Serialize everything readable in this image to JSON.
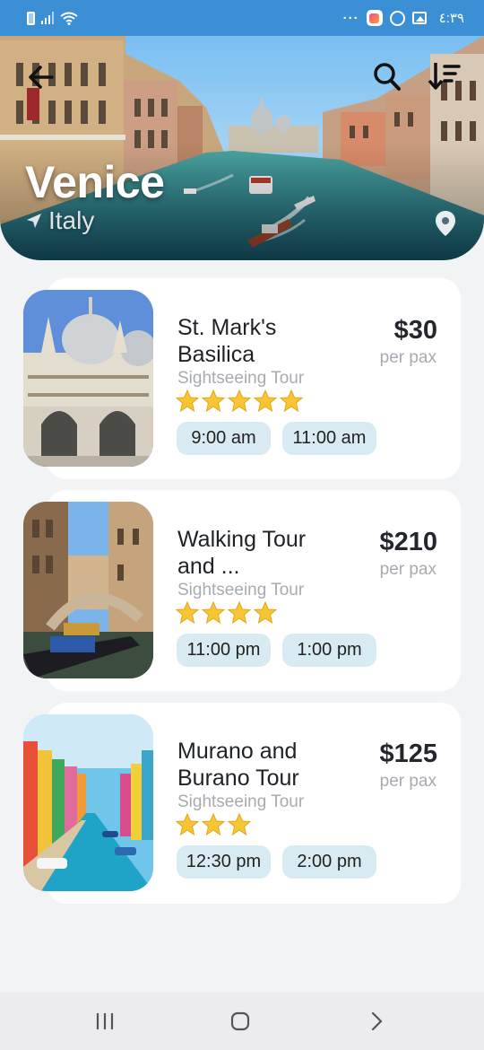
{
  "status_bar": {
    "time": "٤:٣٩",
    "dots": "···",
    "icons": [
      "battery-icon",
      "signal-icon",
      "wifi-icon",
      "health-app-icon",
      "whatsapp-icon",
      "gallery-icon"
    ]
  },
  "header": {
    "city": "Venice",
    "country": "Italy",
    "icons": [
      "back-arrow-icon",
      "search-icon",
      "sort-icon",
      "navigation-arrow-icon",
      "location-pin-icon"
    ]
  },
  "tours": [
    {
      "title_line1": "St. Mark's",
      "title_line2": "Basilica",
      "category": "Sightseeing Tour",
      "price": "$30",
      "price_unit": "per pax",
      "rating": 5,
      "times": [
        "9:00 am",
        "11:00 am"
      ]
    },
    {
      "title_line1": "Walking Tour",
      "title_line2": "and ...",
      "category": "Sightseeing Tour",
      "price": "$210",
      "price_unit": "per pax",
      "rating": 4,
      "times": [
        "11:00 pm",
        "1:00 pm"
      ]
    },
    {
      "title_line1": "Murano and",
      "title_line2": "Burano Tour",
      "category": "Sightseeing Tour",
      "price": "$125",
      "price_unit": "per pax",
      "rating": 3,
      "times": [
        "12:30 pm",
        "2:00 pm"
      ]
    }
  ],
  "colors": {
    "status_bar": "#3b8fd4",
    "chip_background": "#d9ebf2",
    "star": "#f7c534",
    "background": "#f2f3f5"
  },
  "nav": {
    "icons": [
      "recent-apps-icon",
      "home-icon",
      "forward-icon"
    ]
  }
}
